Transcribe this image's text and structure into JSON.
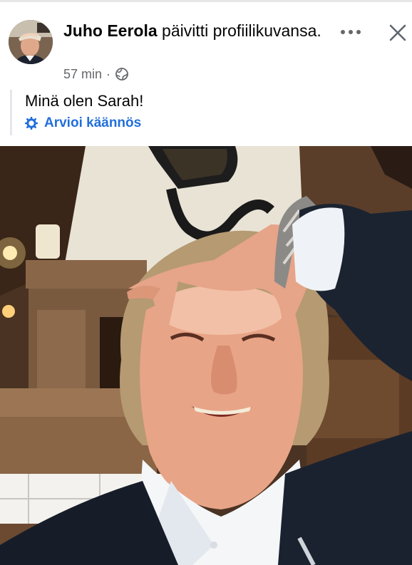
{
  "post": {
    "author_name": "Juho Eerola",
    "action_text": " päivitti profiilikuvansa.",
    "time_ago": "57 min",
    "separator": "·",
    "audience_icon": "globe-icon",
    "text": "Minä olen Sarah!",
    "translate_label": "Arvioi käännös",
    "translate_icon": "gear-icon",
    "more_icon": "more-dots-icon",
    "close_icon": "close-icon"
  },
  "colors": {
    "link_blue": "#216fdb",
    "secondary_text": "#65676b",
    "primary_text": "#050505"
  }
}
